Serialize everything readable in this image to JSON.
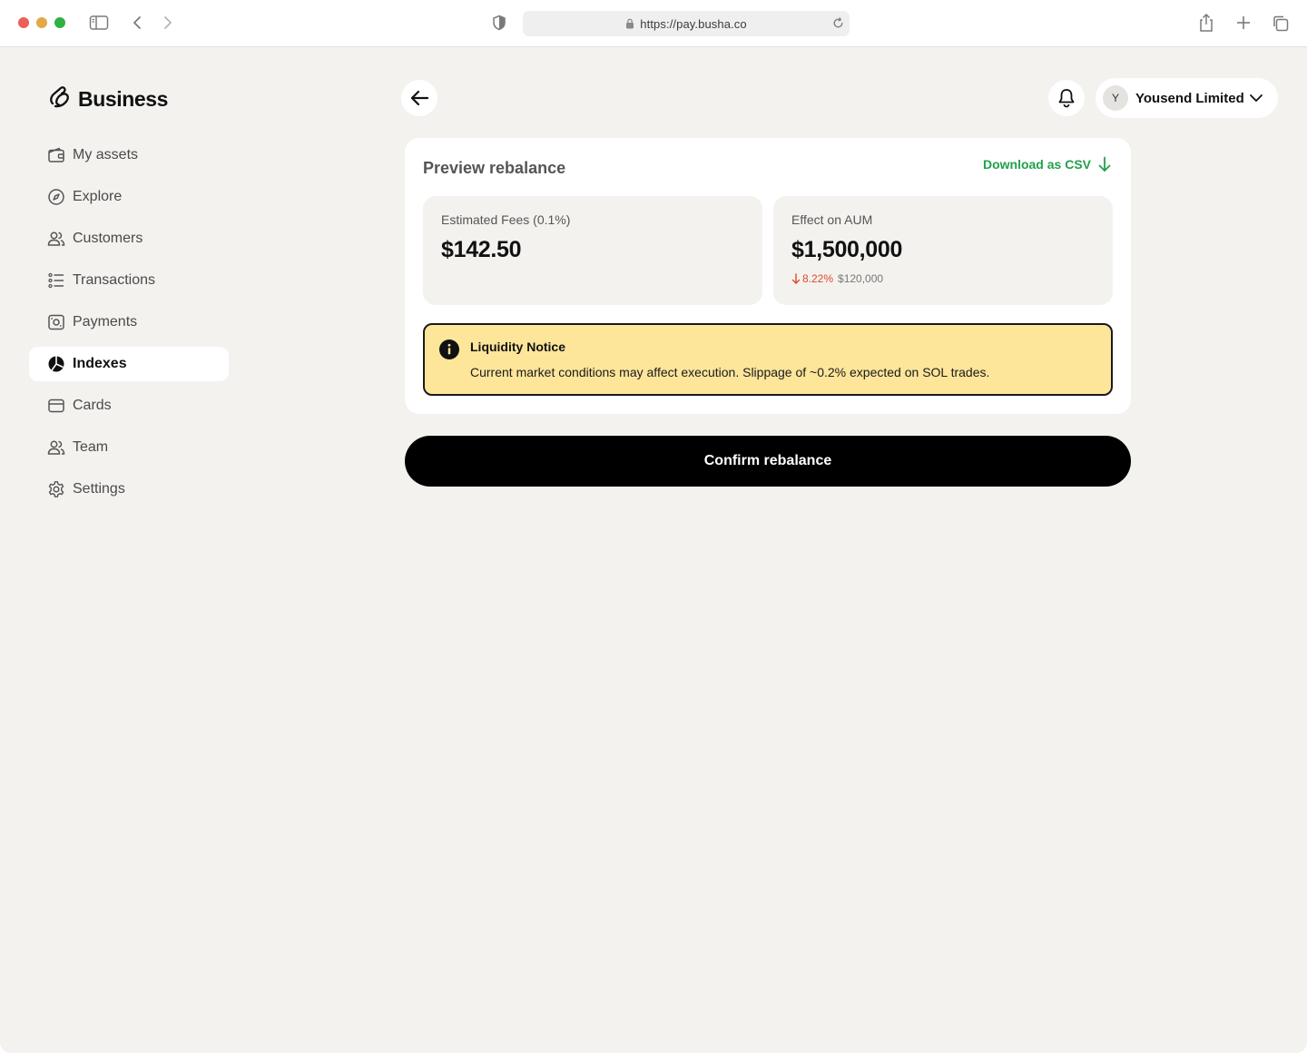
{
  "browser": {
    "url": "https://pay.busha.co"
  },
  "brand": {
    "name": "Business"
  },
  "sidebar": {
    "items": [
      {
        "label": "My assets",
        "icon": "wallet-icon"
      },
      {
        "label": "Explore",
        "icon": "compass-icon"
      },
      {
        "label": "Customers",
        "icon": "users-icon"
      },
      {
        "label": "Transactions",
        "icon": "list-icon"
      },
      {
        "label": "Payments",
        "icon": "payments-icon"
      },
      {
        "label": "Indexes",
        "icon": "pie-chart-icon",
        "active": true
      },
      {
        "label": "Cards",
        "icon": "card-icon"
      },
      {
        "label": "Team",
        "icon": "team-icon"
      },
      {
        "label": "Settings",
        "icon": "gear-icon"
      }
    ]
  },
  "header": {
    "account_initial": "Y",
    "account_name": "Yousend Limited"
  },
  "preview": {
    "title": "Preview rebalance",
    "download_label": "Download as CSV",
    "fees": {
      "label": "Estimated Fees (0.1%)",
      "value": "$142.50"
    },
    "aum": {
      "label": "Effect on AUM",
      "value": "$1,500,000",
      "delta_pct": "8.22%",
      "delta_amount": "$120,000",
      "delta_direction": "down"
    },
    "notice": {
      "title": "Liquidity Notice",
      "body": "Current market conditions may affect execution. Slippage of ~0.2% expected on SOL trades."
    }
  },
  "actions": {
    "confirm_label": "Confirm rebalance"
  },
  "colors": {
    "accent_green": "#22a04b",
    "negative_red": "#e0492c",
    "notice_bg": "#fde59a",
    "page_bg": "#f3f2ef"
  }
}
